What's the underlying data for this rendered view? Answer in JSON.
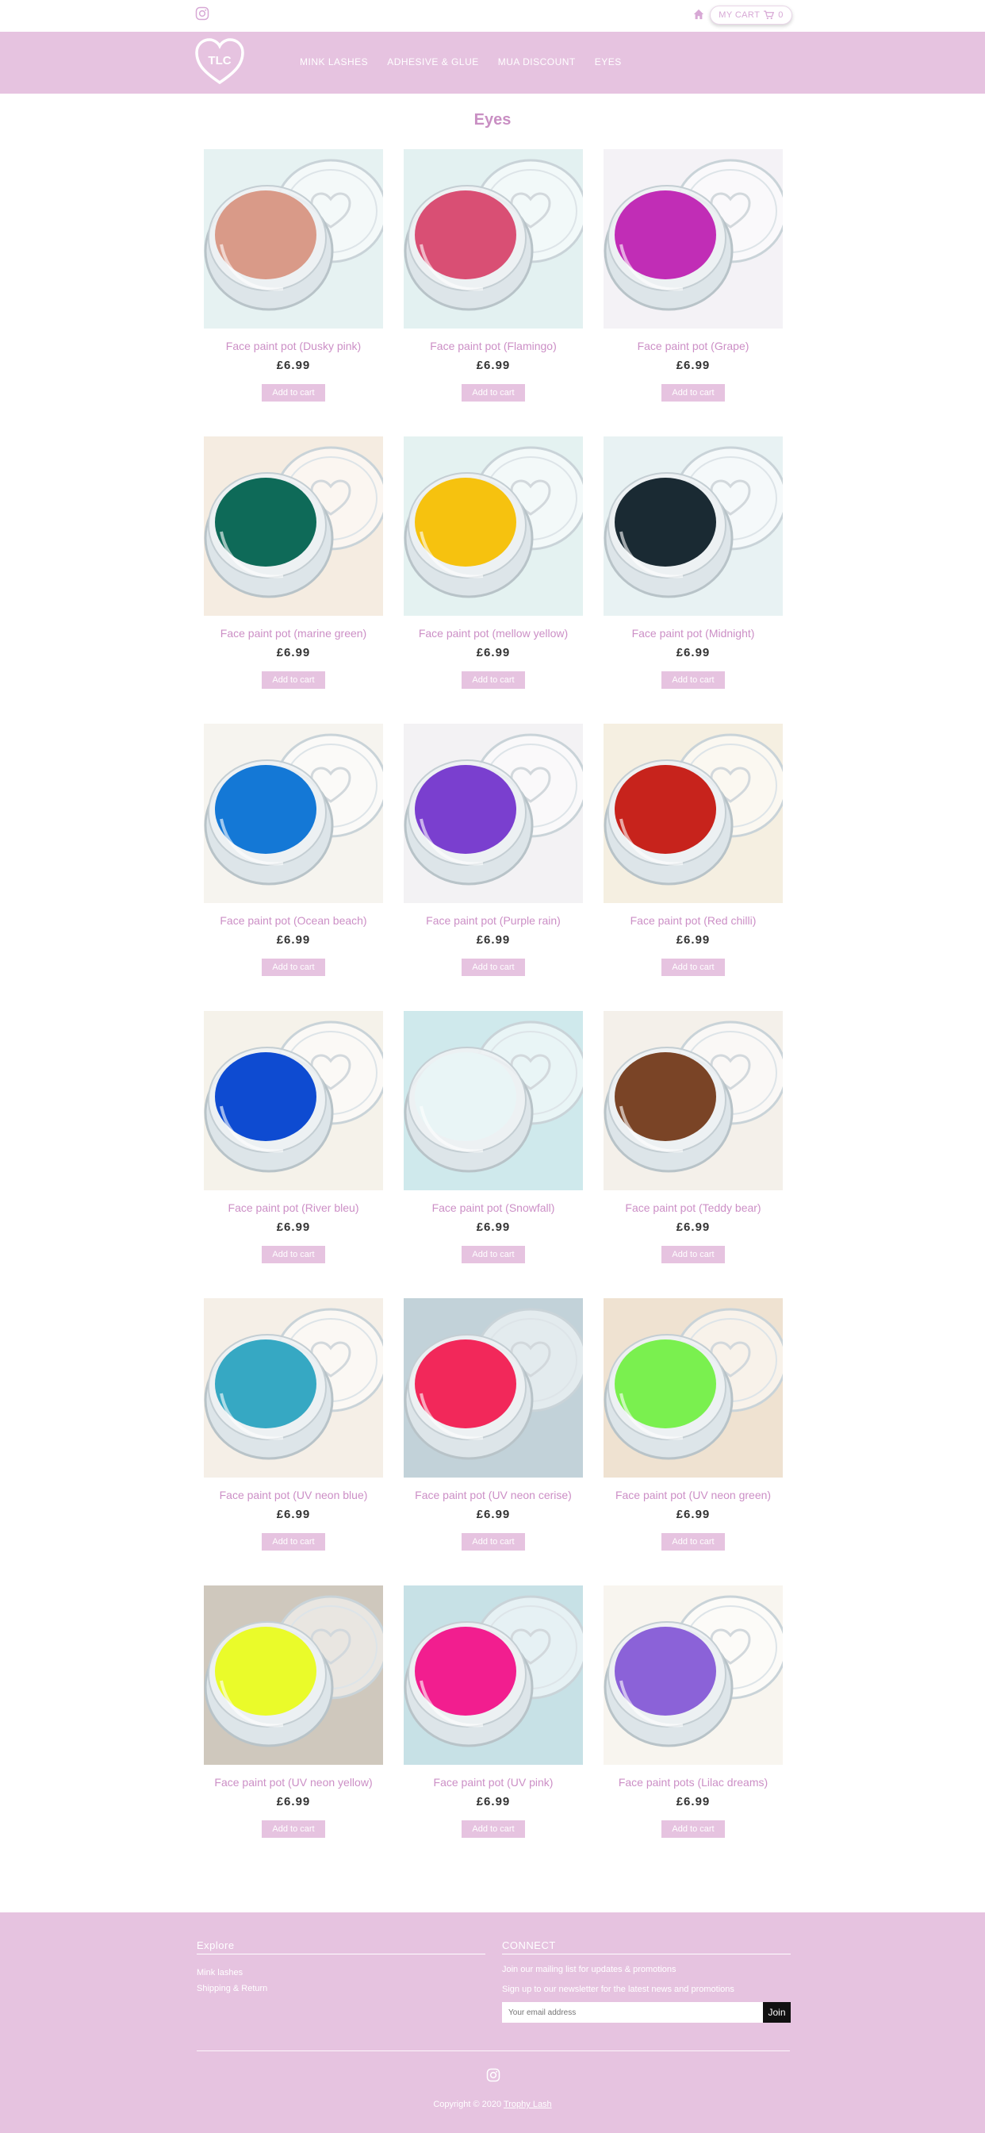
{
  "topbar": {
    "cart_label": "MY CART",
    "cart_count": "0"
  },
  "header": {
    "logo_text": "TLC",
    "nav": [
      "MINK LASHES",
      "ADHESIVE & GLUE",
      "MUA DISCOUNT",
      "EYES"
    ]
  },
  "page_title": "Eyes",
  "add_label": "Add to cart",
  "products": [
    {
      "name": "Face paint pot (Dusky pink)",
      "price": "£6.99",
      "color": "#d99a88",
      "bg": "#e6f2f2"
    },
    {
      "name": "Face paint pot (Flamingo)",
      "price": "£6.99",
      "color": "#d94f74",
      "bg": "#e3f1f1"
    },
    {
      "name": "Face paint pot (Grape)",
      "price": "£6.99",
      "color": "#c12db6",
      "bg": "#f4f2f6"
    },
    {
      "name": "Face paint pot (marine green)",
      "price": "£6.99",
      "color": "#0e6a58",
      "bg": "#f5ece1"
    },
    {
      "name": "Face paint pot (mellow yellow)",
      "price": "£6.99",
      "color": "#f6c20f",
      "bg": "#e4f2f1"
    },
    {
      "name": "Face paint pot (Midnight)",
      "price": "£6.99",
      "color": "#1a2a33",
      "bg": "#e8f2f3"
    },
    {
      "name": "Face paint pot (Ocean beach)",
      "price": "£6.99",
      "color": "#1478d6",
      "bg": "#f6f4ef"
    },
    {
      "name": "Face paint pot (Purple rain)",
      "price": "£6.99",
      "color": "#7a3fcf",
      "bg": "#f3f2f4"
    },
    {
      "name": "Face paint pot (Red chilli)",
      "price": "£6.99",
      "color": "#c7231c",
      "bg": "#f5efe1"
    },
    {
      "name": "Face paint pot (River bleu)",
      "price": "£6.99",
      "color": "#0e4bd1",
      "bg": "#f5f2ea"
    },
    {
      "name": "Face paint pot (Snowfall)",
      "price": "£6.99",
      "color": "#e9f5f6",
      "bg": "#cfe9ec"
    },
    {
      "name": "Face paint pot (Teddy bear)",
      "price": "£6.99",
      "color": "#7a4426",
      "bg": "#f4f0ea"
    },
    {
      "name": "Face paint pot (UV neon blue)",
      "price": "£6.99",
      "color": "#36a8c3",
      "bg": "#f5efe7"
    },
    {
      "name": "Face paint pot (UV neon cerise)",
      "price": "£6.99",
      "color": "#f2285a",
      "bg": "#c2d2d9"
    },
    {
      "name": "Face paint pot (UV neon green)",
      "price": "£6.99",
      "color": "#7af04f",
      "bg": "#efe2d1"
    },
    {
      "name": "Face paint pot (UV neon yellow)",
      "price": "£6.99",
      "color": "#eafb2a",
      "bg": "#cfc8bd"
    },
    {
      "name": "Face paint pot (UV pink)",
      "price": "£6.99",
      "color": "#f21e8f",
      "bg": "#c7e1e6"
    },
    {
      "name": "Face paint pots (Lilac dreams)",
      "price": "£6.99",
      "color": "#8b62d8",
      "bg": "#f8f5ef"
    }
  ],
  "footer": {
    "explore_title": "Explore",
    "explore_links": [
      "Mink lashes",
      "Shipping & Return"
    ],
    "connect_title": "CONNECT",
    "connect_line1": "Join our mailing list for updates & promotions",
    "connect_line2": "Sign up to our newsletter for the latest news and promotions",
    "email_placeholder": "Your email address",
    "join_label": "Join",
    "copyright_prefix": "Copyright © 2020",
    "copyright_link": "Trophy Lash"
  },
  "colors": {
    "brand_pink": "#e6c3e0",
    "title_pink": "#c98fc3",
    "product_name_pink": "#cc8fc6"
  }
}
